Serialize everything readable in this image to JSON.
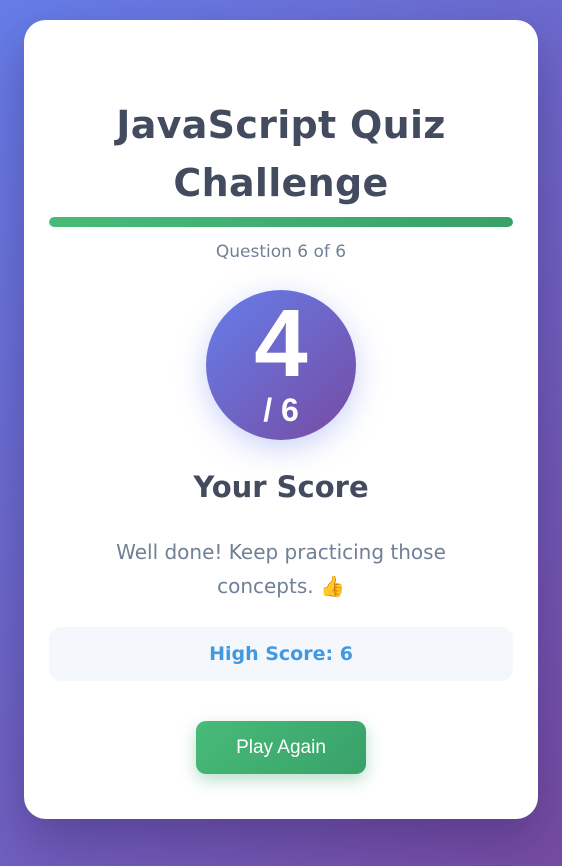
{
  "quiz": {
    "title": "JavaScript Quiz Challenge",
    "progress_fraction": 1.0,
    "question_counter": "Question 6 of 6"
  },
  "result": {
    "score": "4",
    "total": "/ 6",
    "score_label": "Your Score",
    "feedback": "Well done! Keep practicing those concepts. 👍",
    "high_score": "High Score: 6"
  },
  "actions": {
    "play_again_label": "Play Again"
  },
  "colors": {
    "background_gradient_start": "#667eea",
    "background_gradient_end": "#764ba2",
    "progress": "#48bb78",
    "button": "#38a169",
    "high_score_text": "#4299e1",
    "heading_text": "#434b5e"
  }
}
